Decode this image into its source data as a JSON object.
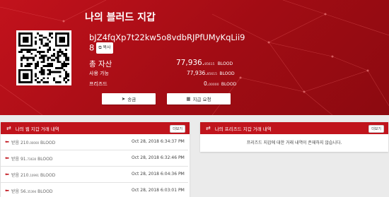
{
  "wallet": {
    "title": "나의 블러드 지갑",
    "address_line1": "bJZ4fqXp7t22kw5o8vdbRJPfUMyKqLii9",
    "address_line2": "8",
    "copy_label": "복사",
    "total_label": "총 자산",
    "total_int": "77,936.",
    "total_dec": "85615",
    "total_unit": "BLOOD",
    "available_label": "사용 가능",
    "available_int": "77,936.",
    "available_dec": "85615",
    "available_unit": "BLOOD",
    "frozen_label": "프리즈드",
    "frozen_int": "0.",
    "frozen_dec": "00000",
    "frozen_unit": "BLOOD",
    "send_label": "송금",
    "request_label": "지급 요청"
  },
  "web_panel": {
    "title": "나의 웹 지갑 거래 내역",
    "more_label": "더보기",
    "rows": [
      {
        "text": "받음 210.",
        "dec": "00000",
        "unit": "BLOOD",
        "date": "Oct 28, 2018 6:34:37 PM"
      },
      {
        "text": "받음 91.",
        "dec": "73630",
        "unit": "BLOOD",
        "date": "Oct 28, 2018 6:32:46 PM"
      },
      {
        "text": "받음 210.",
        "dec": "10991",
        "unit": "BLOOD",
        "date": "Oct 28, 2018 6:04:36 PM"
      },
      {
        "text": "받음 56.",
        "dec": "35394",
        "unit": "BLOOD",
        "date": "Oct 28, 2018 6:03:01 PM"
      }
    ]
  },
  "frozen_panel": {
    "title": "나의 프리즈드 지갑 거래 내역",
    "more_label": "더보기",
    "empty_text": "프리즈드 지갑에 대한 거래 내역이 존재하지 않습니다."
  },
  "colors": {
    "accent": "#c0141c",
    "hero_dark": "#8c0a10"
  },
  "icons": {
    "send": "paper-plane-icon",
    "request": "qr-icon",
    "swap": "swap-arrows-icon",
    "tx": "arrow-left-icon",
    "chevron": "chevron-right-icon"
  }
}
